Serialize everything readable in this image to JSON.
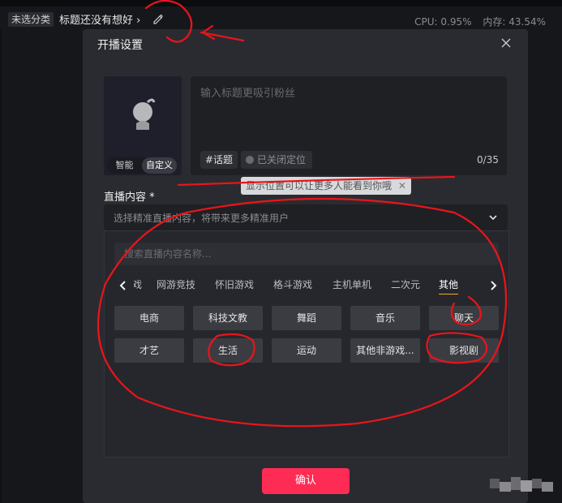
{
  "topbar": {
    "category_tag": "未选分类",
    "stream_title": "标题还没有想好",
    "cpu": "CPU: 0.95%",
    "memory": "内存: 43.54%"
  },
  "dialog": {
    "title": "开播设置",
    "mode_toggle": [
      "智能",
      "自定义"
    ],
    "mode_selected": "自定义",
    "title_placeholder": "输入标题更吸引粉丝",
    "topic_label": "#话题",
    "location_label": "已关闭定位",
    "char_count": "0/35",
    "location_tip": "显示位置可以让更多人能看到你哦",
    "section_label": "直播内容 *",
    "content_select_placeholder": "选择精准直播内容，将带来更多精准用户",
    "search_placeholder": "搜索直播内容名称...",
    "tabs": [
      "戏",
      "网游竞技",
      "怀旧游戏",
      "格斗游戏",
      "主机单机",
      "二次元",
      "其他"
    ],
    "active_tab": "其他",
    "categories": [
      [
        "电商",
        "科技文教",
        "舞蹈",
        "音乐",
        "聊天"
      ],
      [
        "才艺",
        "生活",
        "运动",
        "其他非游戏...",
        "影视剧"
      ]
    ],
    "confirm_label": "确认"
  },
  "colors": {
    "accent": "#fe2c55",
    "tab_underline": "#f5a623",
    "annotation": "#e8151b"
  },
  "icons": [
    "edit-icon",
    "close-icon",
    "avatar-placeholder-icon",
    "chevron-down-icon",
    "chevron-left-icon",
    "chevron-right-icon",
    "tip-close-icon"
  ]
}
